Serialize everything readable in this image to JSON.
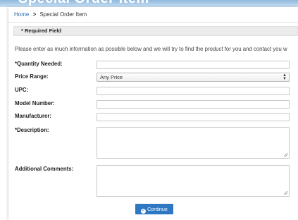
{
  "page_heading": "Special Order Item",
  "breadcrumb": {
    "home": "Home",
    "separator": ">",
    "current": "Special Order Item"
  },
  "required_note": "* Required Field",
  "intro": "Please enter as much information as possible below and we will try to find the product for you and contact you w",
  "fields": {
    "quantity": {
      "label": "*Quantity Needed:",
      "value": ""
    },
    "price_range": {
      "label": "Price Range:",
      "selected": "Any Price"
    },
    "upc": {
      "label": "UPC:",
      "value": ""
    },
    "model_number": {
      "label": "Model Number:",
      "value": ""
    },
    "manufacturer": {
      "label": "Manufacturer:",
      "value": ""
    },
    "description": {
      "label": "*Description:",
      "value": ""
    },
    "comments": {
      "label": "Additional Comments:",
      "value": ""
    }
  },
  "continue_button": {
    "label": "Continue",
    "icon": "check-circle-icon"
  },
  "colors": {
    "link": "#2a6fb5",
    "primary_button": "#2d77c3",
    "required_bar": "#ececec"
  }
}
